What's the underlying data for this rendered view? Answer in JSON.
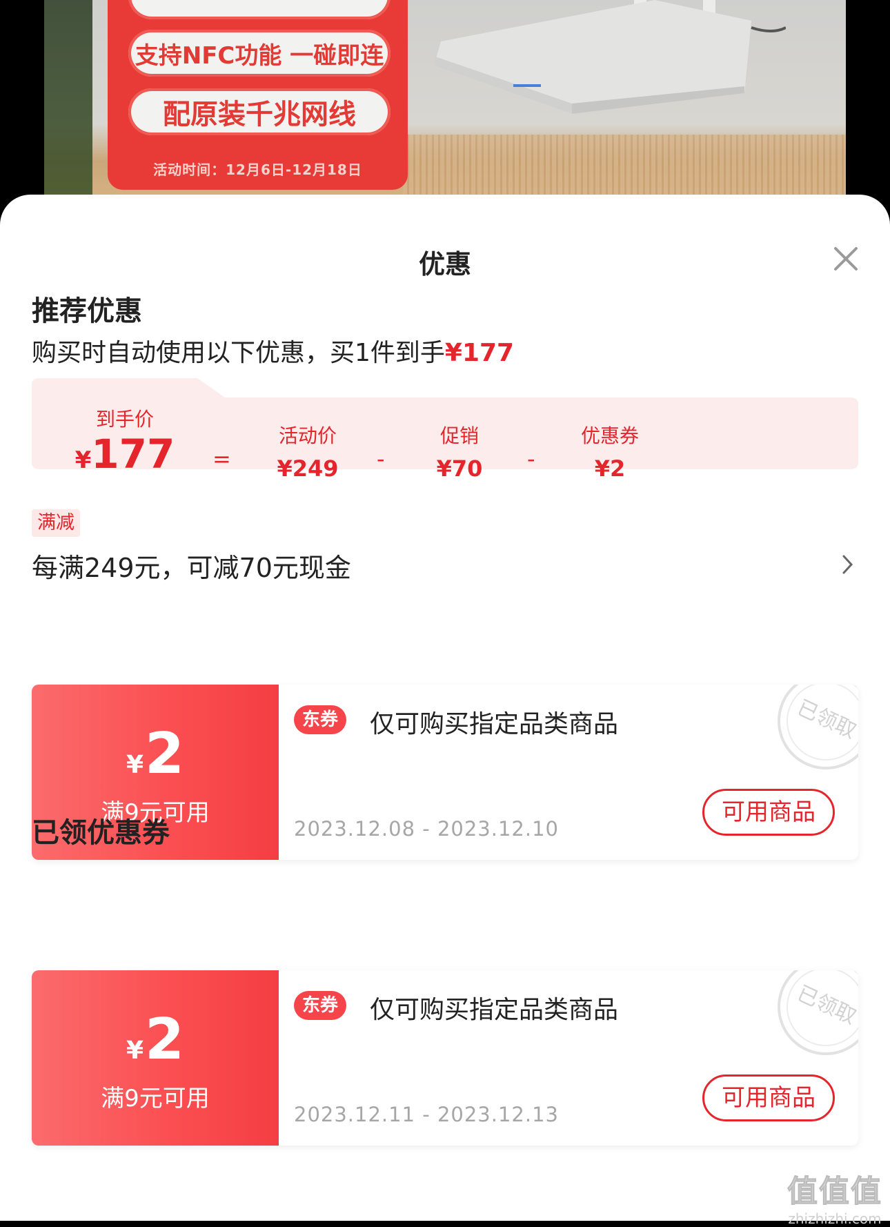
{
  "banner": {
    "promo_lines": [
      "",
      "支持NFC功能 一碰即连",
      "配原装千兆网线"
    ],
    "promo_date": "活动时间：12月6日-12月18日"
  },
  "sheet": {
    "title": "优惠",
    "close_icon": "close-icon"
  },
  "recommended": {
    "title": "推荐优惠",
    "subtitle_prefix": "购买时自动使用以下优惠，买1件到手",
    "subtitle_price": "¥177",
    "breakdown": {
      "final_label": "到手价",
      "final_yen": "¥",
      "final_value": "177",
      "equals": "=",
      "items": [
        {
          "label": "活动价",
          "value": "¥249"
        },
        {
          "label": "促销",
          "value": "¥70"
        },
        {
          "label": "优惠券",
          "value": "¥2"
        }
      ],
      "minus": "-"
    }
  },
  "full_reduction": {
    "tag": "满减",
    "text": "每满249元，可减70元现金",
    "arrow_icon": "chevron-right-icon"
  },
  "coupons_recommended": [
    {
      "yen": "¥",
      "amount": "2",
      "condition": "满9元可用",
      "tag": "东券",
      "description": "仅可购买指定品类商品",
      "date_range": "2023.12.08 - 2023.12.10",
      "button": "可用商品",
      "stamp": "已领取"
    }
  ],
  "claimed": {
    "title": "已领优惠券",
    "coupons": [
      {
        "yen": "¥",
        "amount": "2",
        "condition": "满9元可用",
        "tag": "东券",
        "description": "仅可购买指定品类商品",
        "date_range": "2023.12.11 - 2023.12.13",
        "button": "可用商品",
        "stamp": "已领取"
      }
    ]
  },
  "watermark": {
    "logo": "值值值",
    "text": "zhizhizhi.com"
  },
  "colors": {
    "accent": "#e4262c",
    "coupon_gradient_start": "#fb6b6d",
    "coupon_gradient_end": "#f43e43",
    "breakdown_bg": "#fdecec"
  }
}
